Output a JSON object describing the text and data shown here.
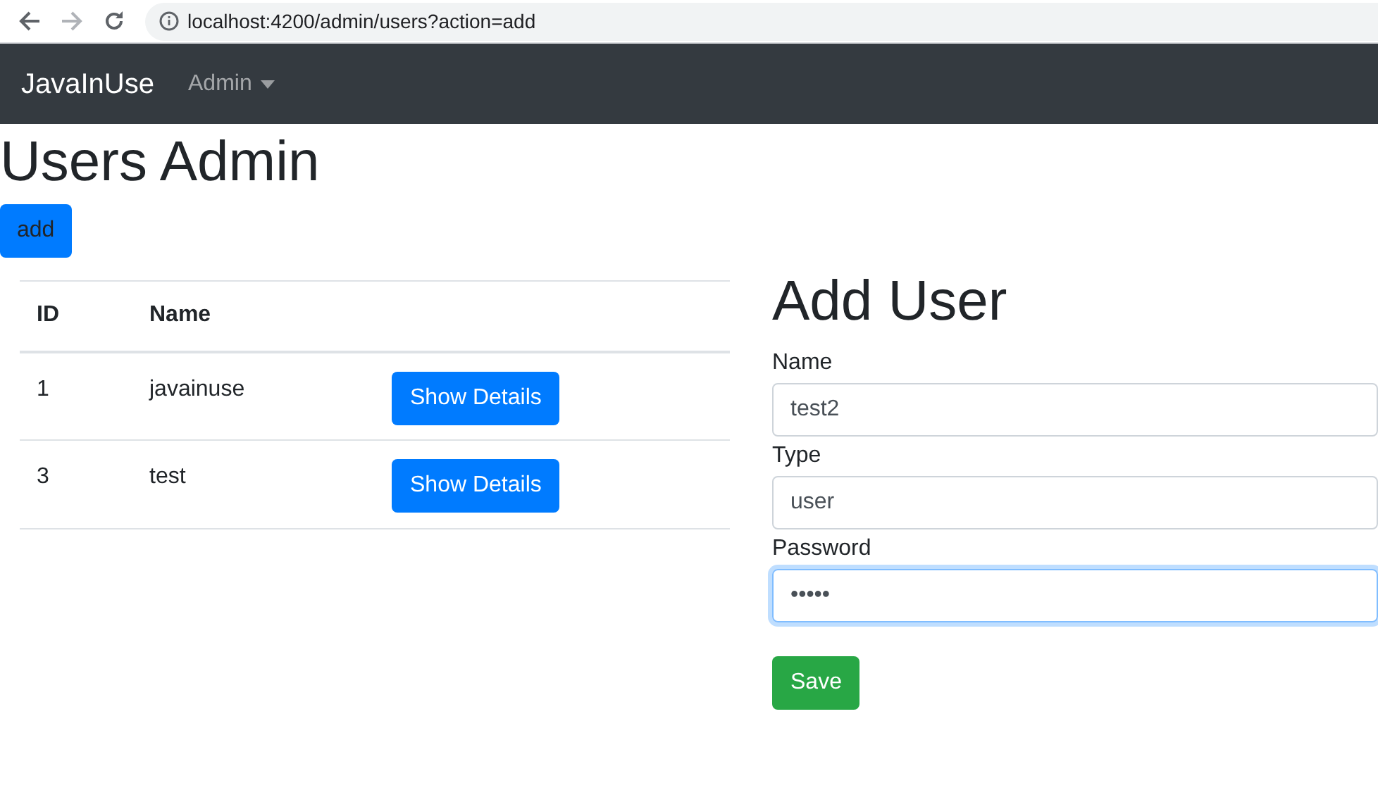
{
  "browser": {
    "url": "localhost:4200/admin/users?action=add"
  },
  "navbar": {
    "brand": "JavaInUse",
    "menu": "Admin"
  },
  "heading": "Users Admin",
  "add_button": "add",
  "table": {
    "columns": [
      "ID",
      "Name"
    ],
    "rows": [
      {
        "id": "1",
        "name": "javainuse",
        "button": "Show Details"
      },
      {
        "id": "3",
        "name": "test",
        "button": "Show Details"
      }
    ]
  },
  "form": {
    "title": "Add User",
    "fields": [
      {
        "label": "Name",
        "value": "test2",
        "focused": false
      },
      {
        "label": "Type",
        "value": "user",
        "focused": false
      },
      {
        "label": "Password",
        "value": "•••••",
        "focused": true
      }
    ],
    "button": "Save"
  }
}
